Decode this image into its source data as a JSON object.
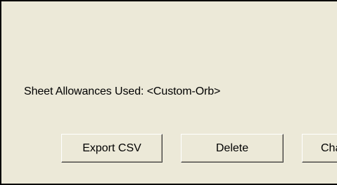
{
  "dialog": {
    "status_text": "Sheet Allowances Used: <Custom-Orb>"
  },
  "buttons": {
    "export_csv": "Export CSV",
    "delete": "Delete",
    "change_partial": "Cha"
  }
}
